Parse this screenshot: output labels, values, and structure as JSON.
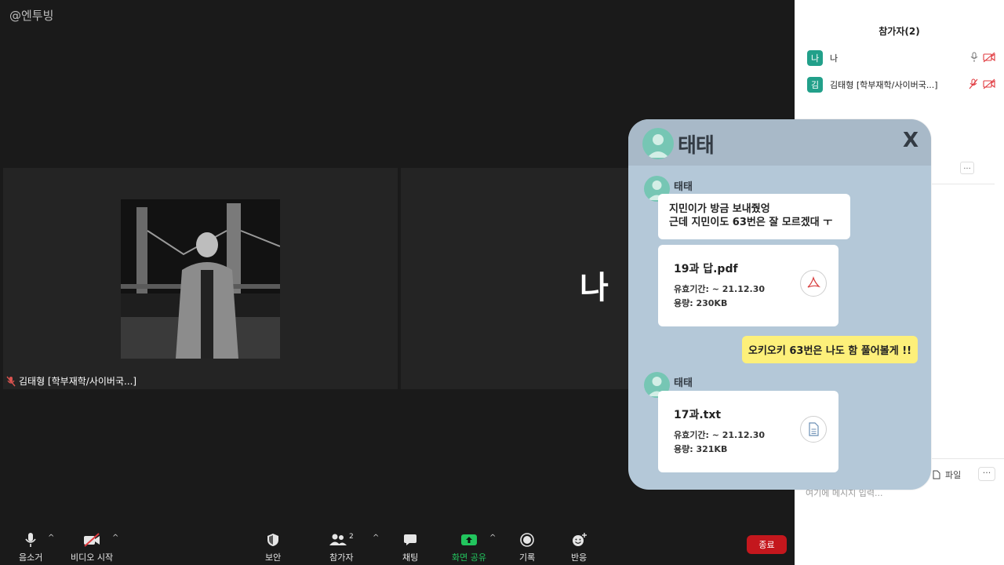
{
  "watermark": "@엔투빙",
  "tiles": {
    "left_name": "김태형 [학부재학/사이버국...]",
    "right_label": "나"
  },
  "toolbar": {
    "mute": "음소거",
    "video": "비디오 시작",
    "security": "보안",
    "participants": "참가자",
    "participants_count": "2",
    "chat": "채팅",
    "share": "화면 공유",
    "record": "기록",
    "reactions": "반응",
    "end": "종료",
    "caret": "^"
  },
  "panel": {
    "title": "참가자(2)",
    "participants": [
      {
        "initial": "나",
        "name": "나"
      },
      {
        "initial": "김",
        "name": "김태형 [학부재학/사이버국...]"
      }
    ],
    "dots": "...",
    "file": "파일",
    "more": "···",
    "message_placeholder": "여기에 메시지 입력..."
  },
  "chat": {
    "title": "태태",
    "close": "X",
    "sender1": "태태",
    "msg1_line1": "지민이가 방금 보내줬엉",
    "msg1_line2": "근데 지민이도 63번은 잘 모르겠대 ㅜ",
    "file1": {
      "name": "19과 답.pdf",
      "expiry": "유효기간: ~ 21.12.30",
      "size": "용량: 230KB"
    },
    "my_msg": "오키오키 63번은 나도 함 풀어볼게 !!",
    "sender2": "태태",
    "file2": {
      "name": "17과.txt",
      "expiry": "유효기간: ~ 21.12.30",
      "size": "용량: 321KB"
    }
  },
  "colors": {
    "chat_bg": "#b4c8d8",
    "chat_header": "#a8b9c8",
    "avatar": "#76c6b4",
    "my_bubble": "#fdf07a",
    "end_button": "#c4171d",
    "share_green": "#22c55e",
    "participant_avatar": "#22a08a"
  }
}
